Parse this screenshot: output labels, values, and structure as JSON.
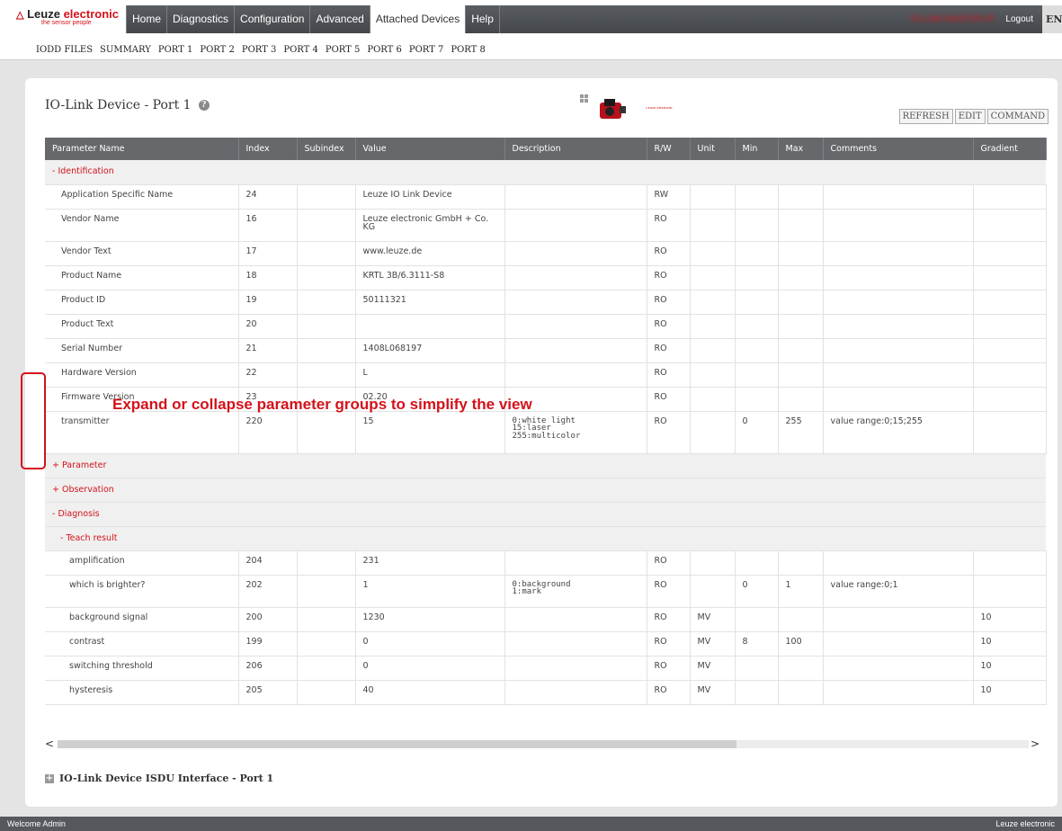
{
  "logo": {
    "brand_part1": "Leuze",
    "brand_part2": "electronic",
    "tagline": "the sensor people"
  },
  "nav": {
    "tabs": [
      "Home",
      "Diagnostics",
      "Configuration",
      "Advanced",
      "Attached Devices",
      "Help"
    ],
    "active": "Attached Devices",
    "ip_text": "IO-LINK-MASTER-IP",
    "logout": "Logout",
    "lang": "EN"
  },
  "subnav": [
    "IODD FILES",
    "SUMMARY",
    "PORT 1",
    "PORT 2",
    "PORT 3",
    "PORT 4",
    "PORT 5",
    "PORT 6",
    "PORT 7",
    "PORT 8"
  ],
  "panel": {
    "title": "IO-Link Device - Port 1",
    "help_glyph": "?",
    "device_logo_text": "Leuze electronic",
    "buttons": {
      "refresh": "REFRESH",
      "edit": "EDIT",
      "command": "COMMAND"
    }
  },
  "table": {
    "columns": [
      "Parameter Name",
      "Index",
      "Subindex",
      "Value",
      "Description",
      "R/W",
      "Unit",
      "Min",
      "Max",
      "Comments",
      "Gradient"
    ],
    "group_identification": "- Identification",
    "identification_rows": [
      [
        "Application Specific Name",
        "24",
        "",
        "Leuze IO Link Device",
        "",
        "RW",
        "",
        "",
        "",
        "",
        ""
      ],
      [
        "Vendor Name",
        "16",
        "",
        "Leuze electronic GmbH + Co. KG",
        "",
        "RO",
        "",
        "",
        "",
        "",
        ""
      ],
      [
        "Vendor Text",
        "17",
        "",
        "www.leuze.de",
        "",
        "RO",
        "",
        "",
        "",
        "",
        ""
      ],
      [
        "Product Name",
        "18",
        "",
        "KRTL 3B/6.3111-S8",
        "",
        "RO",
        "",
        "",
        "",
        "",
        ""
      ],
      [
        "Product ID",
        "19",
        "",
        "50111321",
        "",
        "RO",
        "",
        "",
        "",
        "",
        ""
      ],
      [
        "Product Text",
        "20",
        "",
        "",
        "",
        "RO",
        "",
        "",
        "",
        "",
        ""
      ],
      [
        "Serial Number",
        "21",
        "",
        "1408L068197",
        "",
        "RO",
        "",
        "",
        "",
        "",
        ""
      ],
      [
        "Hardware Version",
        "22",
        "",
        "L",
        "",
        "RO",
        "",
        "",
        "",
        "",
        ""
      ],
      [
        "Firmware Version",
        "23",
        "",
        "02.20",
        "",
        "RO",
        "",
        "",
        "",
        "",
        ""
      ],
      [
        "transmitter",
        "220",
        "",
        "15",
        "0:white light\n15:laser\n255:multicolor",
        "RO",
        "",
        "0",
        "255",
        "value range:0;15;255",
        ""
      ]
    ],
    "group_parameter": "+ Parameter",
    "group_observation": "+ Observation",
    "group_diagnosis": "- Diagnosis",
    "subgroup_teach": "- Teach result",
    "teach_rows": [
      [
        "amplification",
        "204",
        "",
        "231",
        "",
        "RO",
        "",
        "",
        "",
        "",
        ""
      ],
      [
        "which is brighter?",
        "202",
        "",
        "1",
        "0:background\n1:mark",
        "RO",
        "",
        "0",
        "1",
        "value range:0;1",
        ""
      ],
      [
        "background signal",
        "200",
        "",
        "1230",
        "",
        "RO",
        "MV",
        "",
        "",
        "",
        "10"
      ],
      [
        "contrast",
        "199",
        "",
        "0",
        "",
        "RO",
        "MV",
        "8",
        "100",
        "",
        "10"
      ],
      [
        "switching threshold",
        "206",
        "",
        "0",
        "",
        "RO",
        "MV",
        "",
        "",
        "",
        "10"
      ],
      [
        "hysteresis",
        "205",
        "",
        "40",
        "",
        "RO",
        "MV",
        "",
        "",
        "",
        "10"
      ]
    ]
  },
  "callout": "Expand or collapse parameter groups to simplify the view",
  "scroll": {
    "left": "<",
    "right": ">"
  },
  "isdu": {
    "glyph": "+",
    "label": "IO-Link Device ISDU Interface - Port 1"
  },
  "footer": {
    "left": "Welcome Admin",
    "right": "Leuze electronic"
  },
  "colors": {
    "brand_red": "#d3121a",
    "nav_dark": "#4b4e52",
    "header_gray": "#66686b"
  }
}
